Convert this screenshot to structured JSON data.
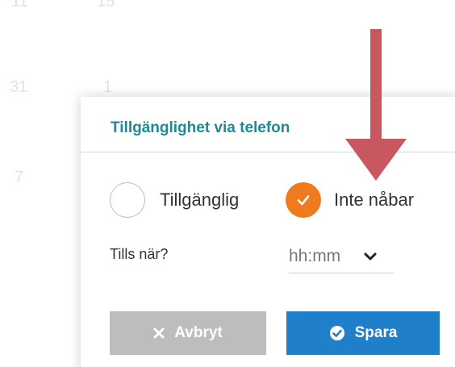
{
  "background_calendar": {
    "top_left": "11",
    "top_mid": "15",
    "day_31": "31",
    "day_1": "1",
    "day_7": "7"
  },
  "dialog": {
    "title": "Tillgänglighet via telefon",
    "options": {
      "available": {
        "label": "Tillgänglig",
        "checked": false
      },
      "unreachable": {
        "label": "Inte nåbar",
        "checked": true
      }
    },
    "until": {
      "label": "Tills när?",
      "time_value": "hh:mm"
    },
    "buttons": {
      "cancel": "Avbryt",
      "save": "Spara"
    }
  },
  "colors": {
    "title": "#1d8a96",
    "radio_checked": "#f07a1e",
    "cancel_button": "#bdbdbd",
    "save_button": "#1f80c9",
    "annotation_arrow": "#c9575f"
  },
  "icons": {
    "cancel": "close-icon",
    "save": "check-circle-icon",
    "dropdown": "chevron-down-icon",
    "radio_check": "checkmark-icon",
    "annotation": "down-arrow-annotation"
  }
}
